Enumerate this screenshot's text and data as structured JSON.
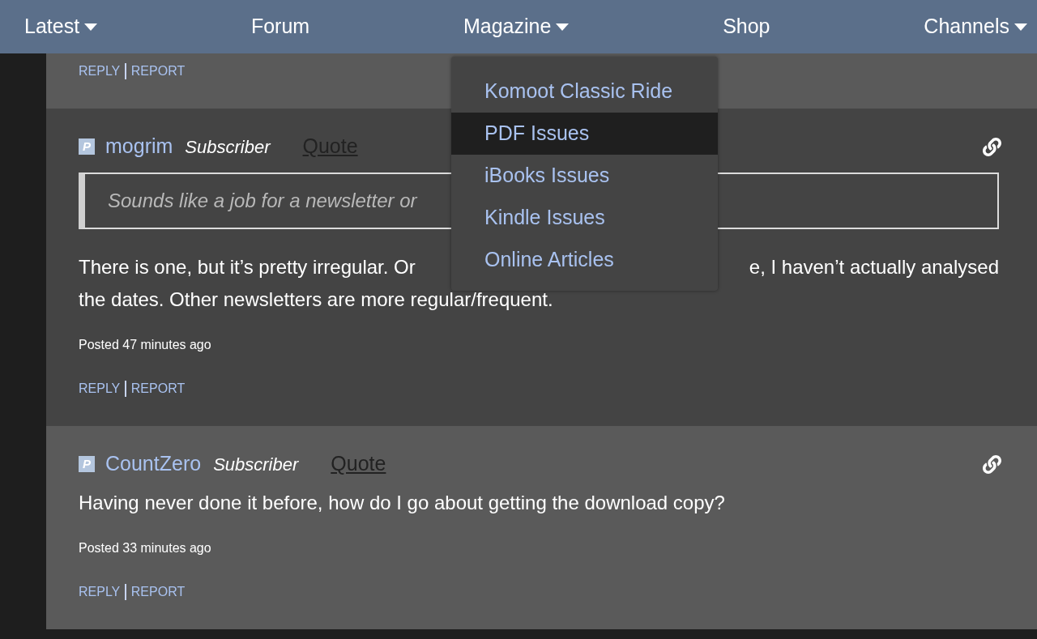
{
  "nav": {
    "items": [
      {
        "label": "Latest",
        "has_menu": true
      },
      {
        "label": "Forum",
        "has_menu": false
      },
      {
        "label": "Magazine",
        "has_menu": true
      },
      {
        "label": "Shop",
        "has_menu": false
      },
      {
        "label": "Channels",
        "has_menu": true
      }
    ]
  },
  "dropdown": {
    "items": [
      {
        "label": "Komoot Classic Ride",
        "selected": false
      },
      {
        "label": "PDF Issues",
        "selected": true
      },
      {
        "label": "iBooks Issues",
        "selected": false
      },
      {
        "label": "Kindle Issues",
        "selected": false
      },
      {
        "label": "Online Articles",
        "selected": false
      }
    ]
  },
  "top_actions": [
    "REPLY",
    "REPORT"
  ],
  "comments": [
    {
      "badge": "P",
      "author": "mogrim",
      "role": "Subscriber",
      "quote_link": "Quote",
      "quoted": "Sounds like a job for a newsletter or",
      "body_lines": [
        [
          "There is one, but it’s pretty irregular. Or",
          "e, I haven’t actually analysed"
        ],
        [
          "the dates. Other newsletters are more regular/frequent."
        ]
      ],
      "posted": "Posted 47 minutes ago",
      "actions": [
        "REPLY",
        "REPORT"
      ]
    },
    {
      "badge": "P",
      "author": "CountZero",
      "role": "Subscriber",
      "quote_link": "Quote",
      "body_lines": [
        [
          "Having never done it before, how do I go about getting the download copy?"
        ]
      ],
      "posted": "Posted 33 minutes ago",
      "actions": [
        "REPLY",
        "REPORT"
      ]
    }
  ]
}
